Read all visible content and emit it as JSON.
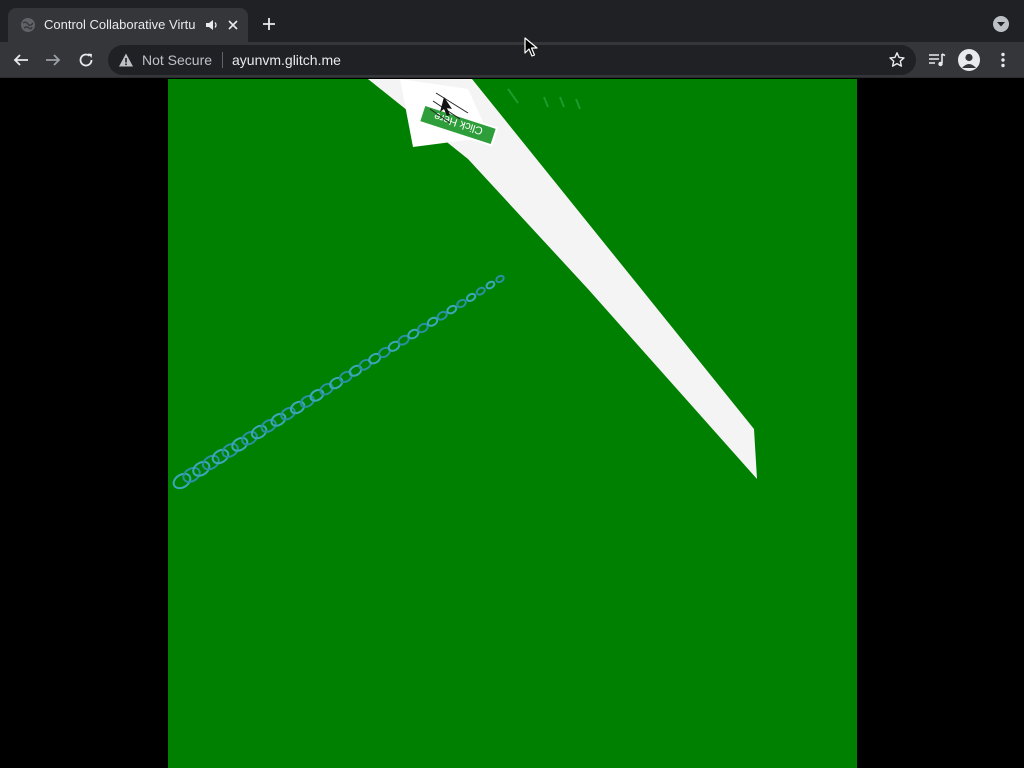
{
  "browser": {
    "tab": {
      "title": "Control Collaborative Virtu",
      "favicon": "globe-icon",
      "audio_icon": "speaker-icon",
      "close_icon": "close-icon"
    },
    "new_tab_icon": "plus-icon",
    "tab_search_icon": "chevron-down-circle-icon",
    "nav": {
      "back_icon": "arrow-left-icon",
      "forward_icon": "arrow-right-icon",
      "reload_icon": "reload-icon"
    },
    "omnibox": {
      "security_icon": "warning-triangle-icon",
      "security_label": "Not Secure",
      "url": "ayunvm.glitch.me",
      "bookmark_icon": "star-icon"
    },
    "toolbar_icons": [
      "media-control-icon",
      "profile-avatar-icon",
      "kebab-menu-icon"
    ]
  },
  "colors": {
    "tabstrip": "#202124",
    "toolbar": "#35363a",
    "scene_background": "#008000",
    "scene_plane": "#ffffff",
    "letterbox": "#000000"
  },
  "scene": {
    "panel_label": "Click Here"
  }
}
